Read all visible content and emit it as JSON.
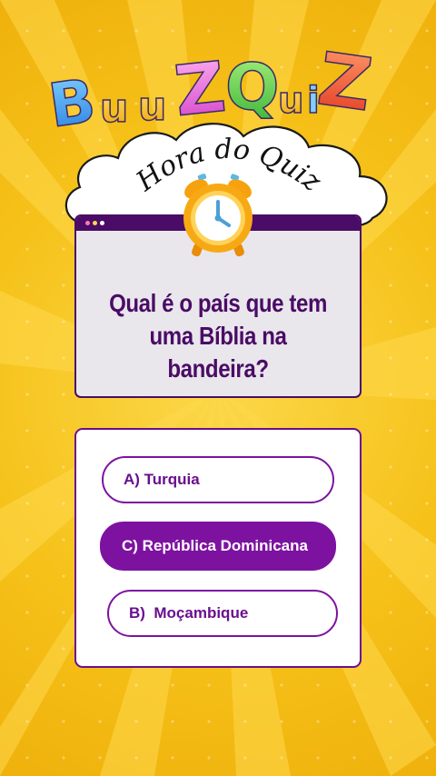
{
  "logo": {
    "text": "BuuZQuiZ"
  },
  "header": {
    "subtitle": "Hora do Quiz"
  },
  "question": {
    "text_line1": "Qual é o país que tem",
    "text_line2": "uma Bíblia na bandeira?"
  },
  "options": [
    {
      "label": "A) Turquia",
      "state": "default"
    },
    {
      "label": "C) República Dominicana",
      "state": "selected"
    },
    {
      "label": "B)  Moçambique",
      "state": "default"
    }
  ],
  "colors": {
    "background": "#f6c21a",
    "accent": "#7d12a0",
    "dark_purple": "#4a0c66",
    "card": "#ffffff"
  },
  "icons": [
    "alarm-clock-icon",
    "window-dots-icon"
  ]
}
